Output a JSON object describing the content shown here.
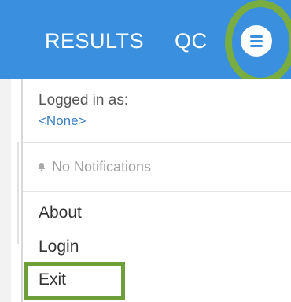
{
  "header": {
    "tabs": [
      {
        "label": "RESULTS"
      },
      {
        "label": "QC"
      }
    ],
    "menu_icon": "hamburger-menu-icon",
    "highlight_color": "#7aad3f"
  },
  "dropdown": {
    "logged_in_label": "Logged in as:",
    "logged_in_user": "<None>",
    "notifications_text": "No Notifications",
    "notifications_icon": "bell-icon",
    "items": [
      {
        "label": "About"
      },
      {
        "label": "Login"
      },
      {
        "label": "Exit"
      }
    ]
  },
  "colors": {
    "topbar": "#3a8fde",
    "user_link": "#3a7ec8",
    "exit_highlight": "#6f9f3a"
  }
}
